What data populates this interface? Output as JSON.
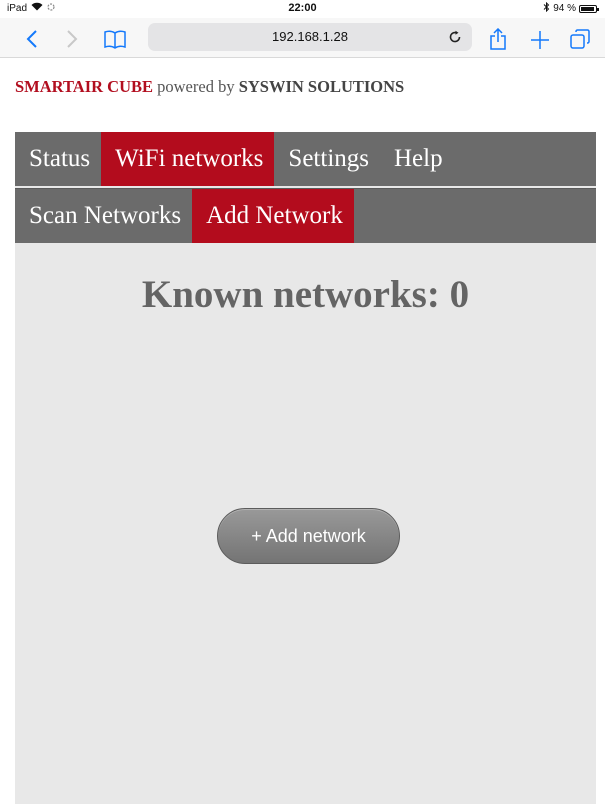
{
  "status_bar": {
    "device": "iPad",
    "time": "22:00",
    "battery": "94 %",
    "battery_level_percent": 94
  },
  "browser": {
    "address": "192.168.1.28",
    "accent_color": "#1479fb"
  },
  "page": {
    "brand_name": "SMARTAIR CUBE",
    "brand_middle": " powered by ",
    "brand_company": "SYSWIN SOLUTIONS",
    "brand_color": "#b20e1f",
    "menu_primary": [
      {
        "label": "Status",
        "active": false
      },
      {
        "label": "WiFi networks",
        "active": true
      },
      {
        "label": "Settings",
        "active": false
      },
      {
        "label": "Help",
        "active": false
      }
    ],
    "menu_secondary": [
      {
        "label": "Scan Networks",
        "active": false
      },
      {
        "label": "Add Network",
        "active": true
      }
    ],
    "active_color": "#b30c1d",
    "heading": "Known networks: 0",
    "add_button_label": "+ Add network"
  }
}
